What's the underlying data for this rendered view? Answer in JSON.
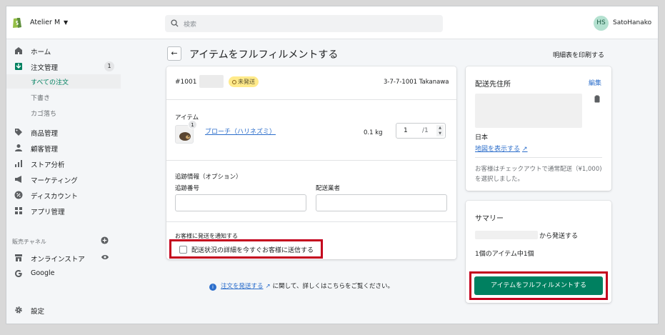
{
  "header": {
    "store_name": "Atelier M",
    "search_placeholder": "検索",
    "user_initials": "HS",
    "user_name": "SatoHanako"
  },
  "sidebar": {
    "items": [
      {
        "label": "ホーム",
        "icon": "home-icon"
      },
      {
        "label": "注文管理",
        "icon": "orders-icon",
        "badge": "1"
      },
      {
        "label": "すべての注文",
        "sub": true,
        "active": true
      },
      {
        "label": "下書き",
        "sub": true
      },
      {
        "label": "カゴ落ち",
        "sub": true
      },
      {
        "label": "商品管理",
        "icon": "tag-icon"
      },
      {
        "label": "顧客管理",
        "icon": "person-icon"
      },
      {
        "label": "ストア分析",
        "icon": "bar-chart-icon"
      },
      {
        "label": "マーケティング",
        "icon": "megaphone-icon"
      },
      {
        "label": "ディスカウント",
        "icon": "discount-icon"
      },
      {
        "label": "アプリ管理",
        "icon": "apps-icon"
      }
    ],
    "channels_label": "販売チャネル",
    "channels": [
      {
        "label": "オンラインストア",
        "icon": "store-icon"
      },
      {
        "label": "Google",
        "icon": "google-icon"
      }
    ],
    "settings_label": "設定"
  },
  "page": {
    "title": "アイテムをフルフィルメントする",
    "print_link": "明細表を印刷する"
  },
  "order": {
    "number": "#1001",
    "status": "未発送",
    "address_short": "3-7-7-1001 Takanawa"
  },
  "items_section": {
    "label": "アイテム",
    "items": [
      {
        "name": "ブローチ（ハリネズミ）",
        "weight": "0.1 kg",
        "qty": "1",
        "qty_max": "/1",
        "count_badge": "1"
      }
    ]
  },
  "tracking": {
    "label": "追跡情報（オプション）",
    "number_label": "追跡番号",
    "carrier_label": "配送業者",
    "number_value": "",
    "carrier_value": ""
  },
  "notify": {
    "label": "お客様に発送を通知する",
    "checkbox_label": "配送状況の詳細を今すぐお客様に送信する"
  },
  "footer": {
    "link": "注文を発送する",
    "text": "に関して、詳しくはこちらをご覧ください。"
  },
  "shipping": {
    "title": "配送先住所",
    "edit": "編集",
    "country": "日本",
    "map_link": "地図を表示する",
    "note": "お客様はチェックアウトで通常配送（¥1,000)を選択しました。"
  },
  "summary": {
    "title": "サマリー",
    "from_text": "から発送する",
    "count_text": "1個のアイテム中1個",
    "button": "アイテムをフルフィルメントする"
  },
  "colors": {
    "primary": "#008060",
    "link": "#2c6ecb",
    "highlight": "#c4001d",
    "status": "#ffea8a"
  }
}
